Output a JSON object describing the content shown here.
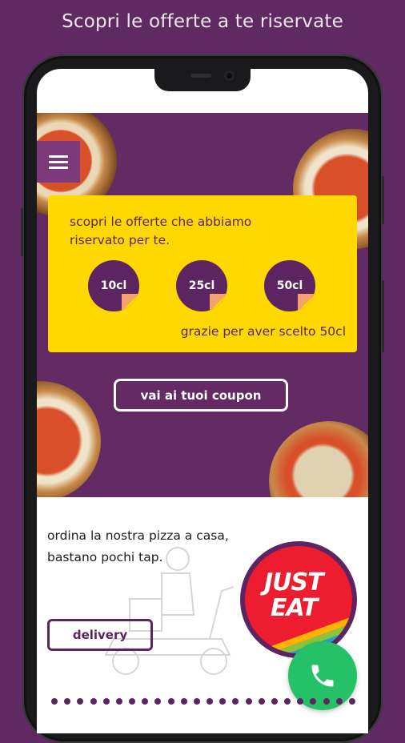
{
  "headline": "Scopri le offerte a te riservate",
  "offer": {
    "text": "scopri le offerte che abbiamo riservato per te.",
    "coupons": [
      "10cl",
      "25cl",
      "50cl"
    ],
    "thanks": "grazie per aver scelto 50cl"
  },
  "coupon_button": "vai ai tuoi coupon",
  "order": {
    "text": "ordina la nostra pizza a casa, bastano pochi tap.",
    "delivery_label": "delivery"
  },
  "just_eat": {
    "line1": "JUST",
    "line2": "EAT"
  },
  "icons": {
    "menu": "hamburger-menu-icon",
    "call": "phone-icon",
    "scooter": "scooter-delivery-icon"
  },
  "colors": {
    "purple": "#632a63",
    "yellow": "#ffd800",
    "green": "#25c167",
    "just_eat_red": "#ed1c2e"
  }
}
